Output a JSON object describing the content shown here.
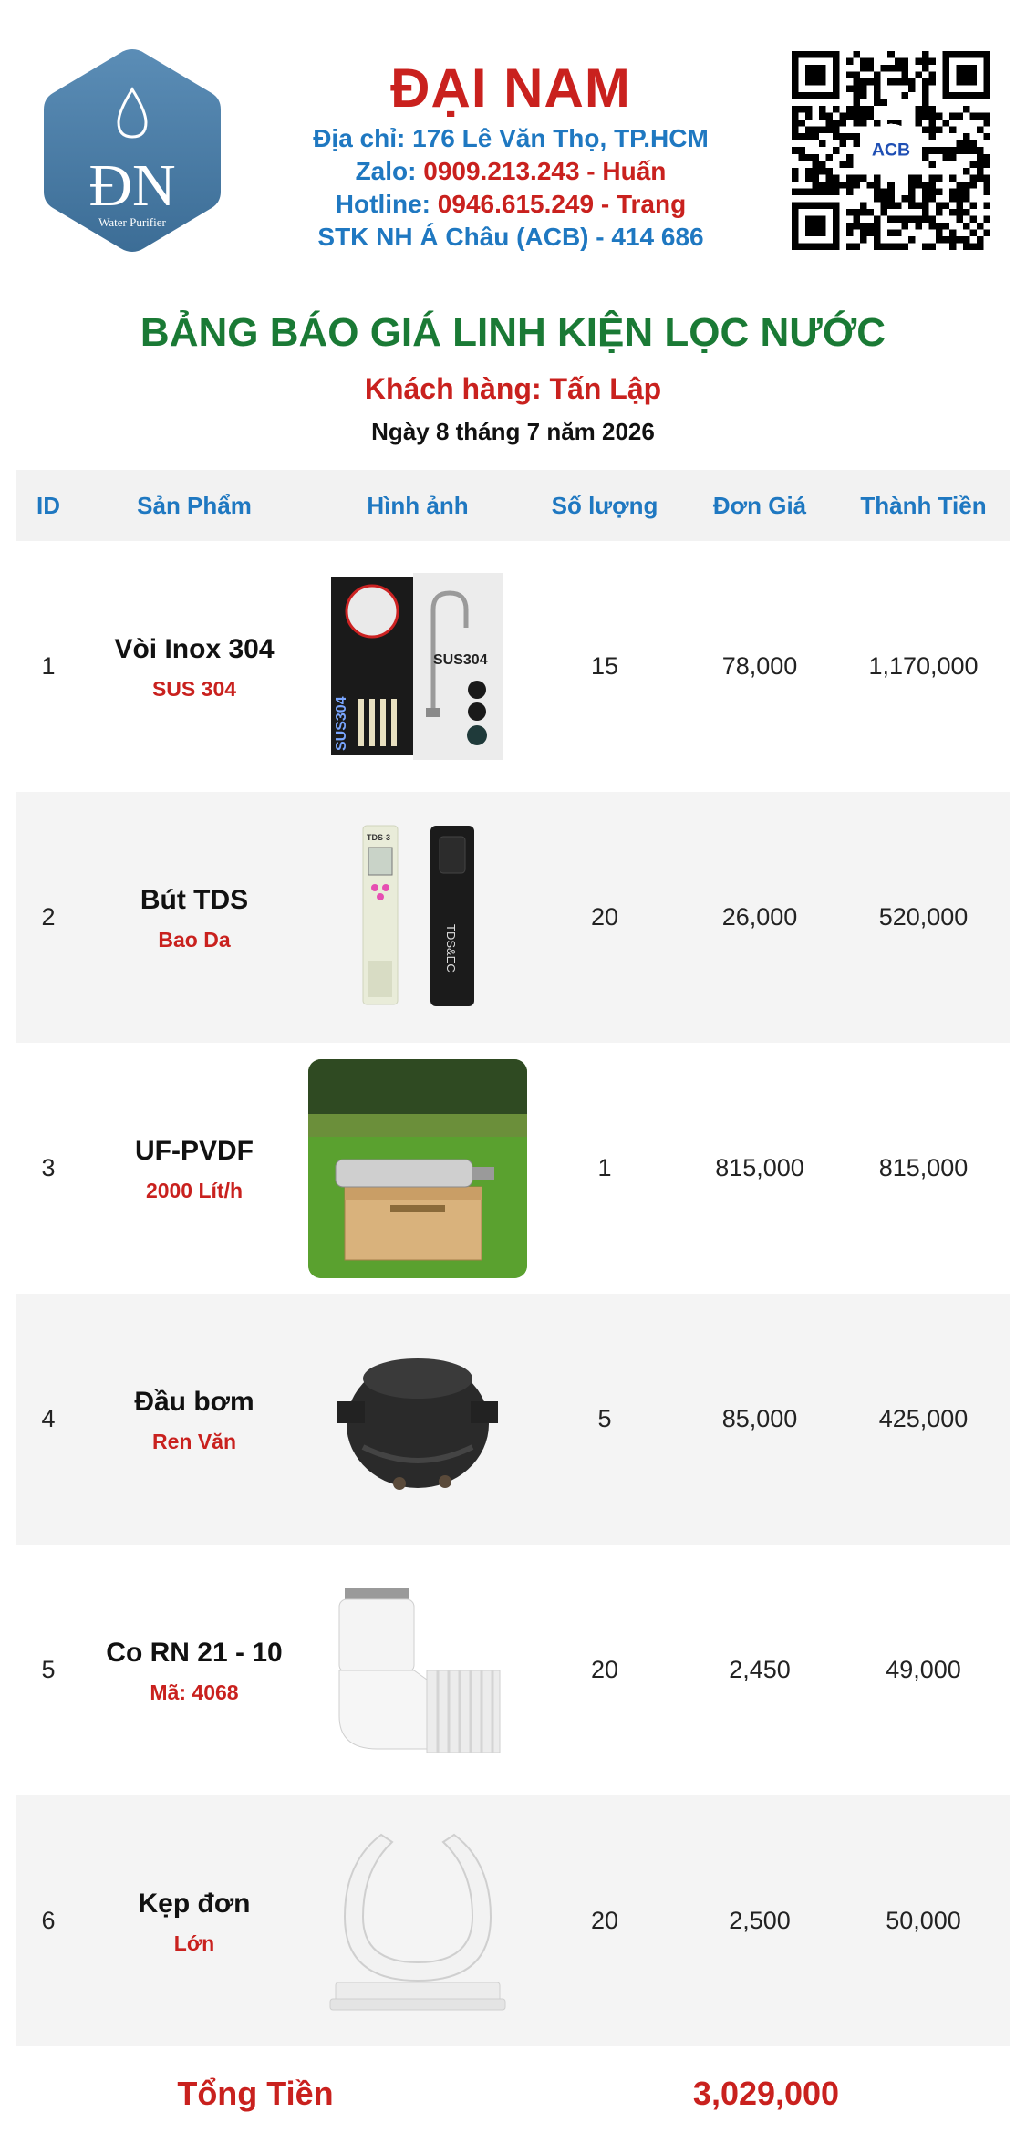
{
  "header": {
    "logo_text": "ĐN",
    "logo_sub": "Water Purifier",
    "company_name": "ĐẠI NAM",
    "address_label": "Địa chỉ: ",
    "address_value": "176 Lê Văn Thọ, TP.HCM",
    "zalo_label": "Zalo: ",
    "zalo_value": "0909.213.243 - Huấn",
    "hotline_label": "Hotline: ",
    "hotline_value": "0946.615.249 - Trang",
    "bank_line": "STK NH Á Châu (ACB) - 414 686",
    "qr_badge": "ACB"
  },
  "title": "BẢNG BÁO GIÁ LINH KIỆN LỌC NƯỚC",
  "customer": "Khách hàng: Tấn Lập",
  "date": "Ngày 8 tháng 7 năm 2026",
  "table": {
    "headers": [
      "ID",
      "Sản Phẩm",
      "Hình ảnh",
      "Số lượng",
      "Đơn Giá",
      "Thành Tiền"
    ],
    "rows": [
      {
        "id": "1",
        "name": "Vòi Inox 304",
        "sub": "SUS 304",
        "qty": "15",
        "price": "78,000",
        "total": "1,170,000",
        "image_icon": "faucet-kit-image",
        "image_labels": [
          "SUS304",
          "SUS304"
        ]
      },
      {
        "id": "2",
        "name": "Bút TDS",
        "sub": "Bao Da",
        "qty": "20",
        "price": "26,000",
        "total": "520,000",
        "image_icon": "tds-pen-image",
        "image_labels": [
          "TDS-3",
          "TDS&EC"
        ]
      },
      {
        "id": "3",
        "name": "UF-PVDF",
        "sub": "2000 Lít/h",
        "qty": "1",
        "price": "815,000",
        "total": "815,000",
        "image_icon": "uf-filter-image"
      },
      {
        "id": "4",
        "name": "Đầu bơm",
        "sub": "Ren Văn",
        "qty": "5",
        "price": "85,000",
        "total": "425,000",
        "image_icon": "pump-head-image"
      },
      {
        "id": "5",
        "name": "Co RN 21 - 10",
        "sub": "Mã: 4068",
        "qty": "20",
        "price": "2,450",
        "total": "49,000",
        "image_icon": "elbow-fitting-image"
      },
      {
        "id": "6",
        "name": "Kẹp đơn",
        "sub": "Lớn",
        "qty": "20",
        "price": "2,500",
        "total": "50,000",
        "image_icon": "pipe-clamp-image"
      }
    ]
  },
  "total_label": "Tổng Tiền",
  "total_value": "3,029,000",
  "colors": {
    "brand_red": "#c9211e",
    "brand_blue": "#1f78c1",
    "title_green": "#1a7a35",
    "row_shade": "#f4f4f4",
    "logo_blue": "#4a7ea8"
  }
}
